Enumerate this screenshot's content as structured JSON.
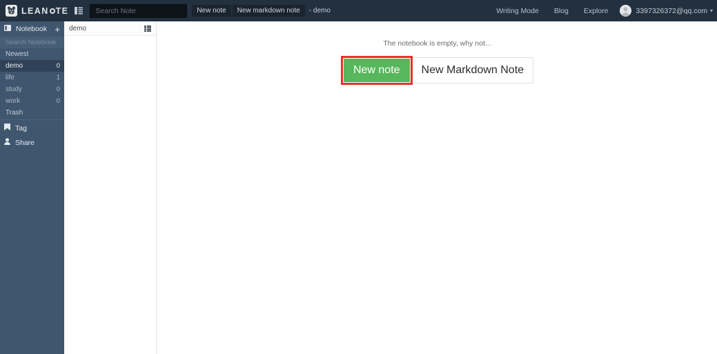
{
  "app": {
    "brand": "LEANOTE",
    "logo_icon": "bear-logo-icon",
    "sidebar_toggle_icon": "list-toggle-icon"
  },
  "topbar": {
    "search": {
      "placeholder": "Search Note",
      "value": ""
    },
    "buttons": [
      {
        "label": "New note",
        "name": "new-note-toolbar-button"
      },
      {
        "label": "New markdown note",
        "name": "new-markdown-note-toolbar-button"
      }
    ],
    "current_notebook": "- demo",
    "nav_links": [
      {
        "label": "Writing Mode"
      },
      {
        "label": "Blog"
      },
      {
        "label": "Explore"
      }
    ],
    "user": {
      "email": "3397326372@qq.com",
      "caret": "▾",
      "avatar_icon": "user-avatar-icon"
    }
  },
  "sidebar": {
    "notebook_section": {
      "label": "Notebook",
      "icon": "notebook-icon",
      "add_label": "+"
    },
    "search_notebook": {
      "placeholder": "Search Notebook",
      "value": ""
    },
    "items": [
      {
        "label": "Newest",
        "count": "",
        "selected": false,
        "type": "plain"
      },
      {
        "label": "demo",
        "count": "0",
        "selected": true,
        "type": "notebook"
      },
      {
        "label": "life",
        "count": "1",
        "selected": false,
        "type": "notebook"
      },
      {
        "label": "study",
        "count": "0",
        "selected": false,
        "type": "notebook"
      },
      {
        "label": "work",
        "count": "0",
        "selected": false,
        "type": "notebook"
      },
      {
        "label": "Trash",
        "count": "",
        "selected": false,
        "type": "plain"
      }
    ],
    "tag_section": {
      "label": "Tag",
      "icon": "tag-icon"
    },
    "share_section": {
      "label": "Share",
      "icon": "share-user-icon"
    }
  },
  "notelist": {
    "title": "demo",
    "view_icon": "list-view-icon",
    "notes": []
  },
  "main": {
    "empty_message": "The notebook is empty, why not...",
    "new_note_label": "New note",
    "new_markdown_label": "New Markdown Note",
    "highlight_color": "#e8302a",
    "primary_color": "#57b75c"
  }
}
